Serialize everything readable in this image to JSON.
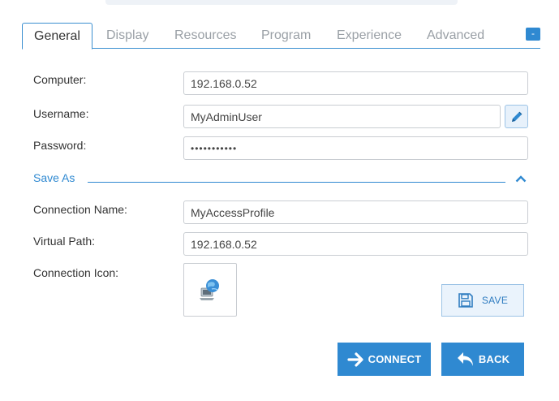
{
  "tabs": [
    {
      "label": "General",
      "active": true
    },
    {
      "label": "Display"
    },
    {
      "label": "Resources"
    },
    {
      "label": "Program"
    },
    {
      "label": "Experience"
    },
    {
      "label": "Advanced"
    }
  ],
  "collapse_glyph": "-",
  "fields": {
    "computer": {
      "label": "Computer:",
      "value": "192.168.0.52"
    },
    "username": {
      "label": "Username:",
      "value": "MyAdminUser"
    },
    "password": {
      "label": "Password:",
      "value": "•••••••••••"
    }
  },
  "save_as": {
    "title": "Save As",
    "connection_name": {
      "label": "Connection Name:",
      "value": "MyAccessProfile"
    },
    "virtual_path": {
      "label": "Virtual Path:",
      "value": "192.168.0.52"
    },
    "connection_icon": {
      "label": "Connection Icon:",
      "icon": "computer-globe-icon"
    }
  },
  "buttons": {
    "save": "SAVE",
    "connect": "CONNECT",
    "back": "BACK"
  },
  "colors": {
    "accent": "#2f89d1",
    "save_bg": "#eaf3fc",
    "border": "#c9cdd2"
  }
}
